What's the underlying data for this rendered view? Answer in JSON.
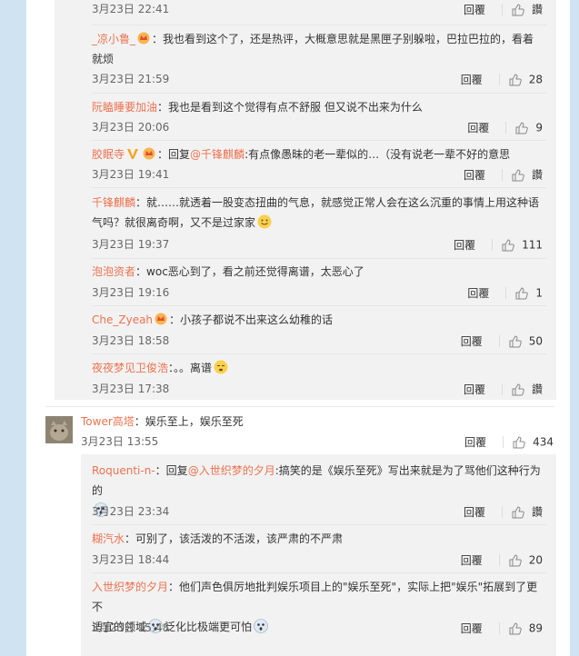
{
  "comments": [
    {
      "time": "3月23日 22:41",
      "reply": "回覆",
      "likes": "讚"
    },
    {
      "user": "_凉小鲁_",
      "badge": "crown-badge",
      "sep": "：",
      "text": "我也看到这个了，还是热评，大概意思就是黑匣子别躲啦，巴拉巴拉的，看着",
      "text2": "就烦",
      "time": "3月23日 21:59",
      "reply": "回覆",
      "likes": "28"
    },
    {
      "user": "阮瞌睡要加油",
      "sep": "：",
      "text": "我也是看到这个觉得有点不舒服 但又说不出来为什么",
      "time": "3月23日 20:06",
      "reply": "回覆",
      "likes": "9"
    },
    {
      "user": "胶眠寺",
      "badge": "v-badge",
      "sep": "：",
      "pre": "回复",
      "at": "@千锋麒麟",
      "text": ":有点像愚昧的老一辈似的…（没有说老一辈不好的意思",
      "time": "3月23日 19:41",
      "reply": "回覆",
      "likes": "讚"
    },
    {
      "user": "千锋麒麟",
      "sep": "：",
      "text": "就……就透着一股变态扭曲的气息，就感觉正常人会在这么沉重的事情上用这种语",
      "text2": "气吗？就很离奇啊，又不是过家家",
      "time": "3月23日 19:37",
      "reply": "回覆",
      "likes": "111"
    },
    {
      "user": "泡泡资者",
      "sep": "：",
      "text": "woc恶心到了，看之前还觉得离谱，太恶心了",
      "time": "3月23日 19:16",
      "reply": "回覆",
      "likes": "1"
    },
    {
      "user": "Che_Zyeah",
      "badge": "crown-badge",
      "sep": "：",
      "text": "小孩子都说不出来这么幼稚的话",
      "time": "3月23日 18:58",
      "reply": "回覆",
      "likes": "50"
    },
    {
      "user": "夜夜梦见卫俊浩",
      "sep": "：",
      "text": "。。离谱",
      "time": "3月23日 17:38",
      "reply": "回覆",
      "likes": "讚"
    }
  ],
  "main_comment": {
    "user": "Tower高塔",
    "sep": "：",
    "text": "娱乐至上，娱乐至死",
    "time": "3月23日 13:55",
    "reply": "回覆",
    "likes": "434"
  },
  "sub_comments": [
    {
      "user": "Roquenti-n-",
      "sep": "：",
      "pre": "回复",
      "at": "@入世织梦的夕月",
      "text": ":搞笑的是《娱乐至死》写出来就是为了骂他们这种行为的",
      "time": "3月23日 23:34",
      "reply": "回覆",
      "likes": "讚"
    },
    {
      "user": "糊汽水",
      "sep": "：",
      "text": "可别了，该活泼的不活泼，该严肃的不严肃",
      "time": "3月23日 18:44",
      "reply": "回覆",
      "likes": "20"
    },
    {
      "user": "入世织梦的夕月",
      "sep": "：",
      "text": "他们声色俱厉地批判娱乐项目上的\"娱乐至死\"，实际上把\"娱乐\"拓展到了更不",
      "text2": "适宜的领域",
      "text3": "泛化比极端更可怕",
      "time": "3月23日 15:48",
      "reply": "回覆",
      "likes": "89"
    }
  ]
}
